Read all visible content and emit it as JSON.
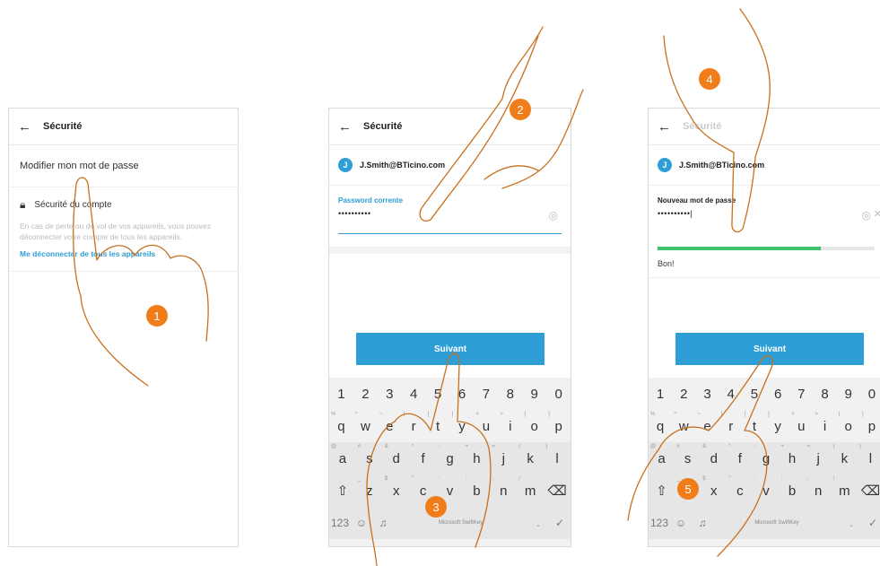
{
  "screen1": {
    "back_icon": "←",
    "title": "Sécurité",
    "change_password_label": "Modifier mon mot de passe",
    "security_heading": "Sécurité du compte",
    "security_desc": "En cas de perte ou de vol de vos appareils, vous pouvez déconnecter votre compte de tous les appareils.",
    "logout_link": "Me déconnecter de tous les appareils"
  },
  "screen2": {
    "back_icon": "←",
    "title": "Sécurité",
    "account_initial": "J",
    "account_email": "J.Smith@BTicino.com",
    "field_label": "Password corrente",
    "field_value": "••••••••••",
    "next_button": "Suivant"
  },
  "screen3": {
    "back_icon": "←",
    "title": "Sécurité",
    "account_initial": "J",
    "account_email": "J.Smith@BTicino.com",
    "field_label": "Nouveau mot de passe",
    "field_value": "••••••••••|",
    "strength_level": 0.75,
    "strength_text": "Bon!",
    "next_button": "Suivant"
  },
  "keyboard": {
    "numbers": [
      "1",
      "2",
      "3",
      "4",
      "5",
      "6",
      "7",
      "8",
      "9",
      "0"
    ],
    "row1": [
      "q",
      "w",
      "e",
      "r",
      "t",
      "y",
      "u",
      "i",
      "o",
      "p"
    ],
    "row1_sup": [
      "%",
      "^",
      "~",
      "|",
      "[",
      "]",
      "<",
      ">",
      "{",
      "}"
    ],
    "row2": [
      "a",
      "s",
      "d",
      "f",
      "g",
      "h",
      "j",
      "k",
      "l"
    ],
    "row2_sup": [
      "@",
      "#",
      "&",
      "*",
      "-",
      "+",
      "=",
      "(",
      ")"
    ],
    "row3": [
      "z",
      "x",
      "c",
      "v",
      "b",
      "n",
      "m"
    ],
    "row3_sup": [
      "_",
      "$",
      "\"",
      "'",
      ":",
      ";",
      "/"
    ],
    "shift_icon": "⇧",
    "backspace_icon": "⌫",
    "symbols_key": "123",
    "emoji_icon": "☺",
    "mic_icon": "♫",
    "space_label": "Microsoft SwiftKey",
    "period_key": ".",
    "enter_icon": "✓"
  },
  "steps": [
    "1",
    "2",
    "3",
    "4",
    "5"
  ],
  "colors": {
    "accent": "#2d9fd6",
    "step_badge": "#f07d1a",
    "strength": "#3ec46d"
  }
}
